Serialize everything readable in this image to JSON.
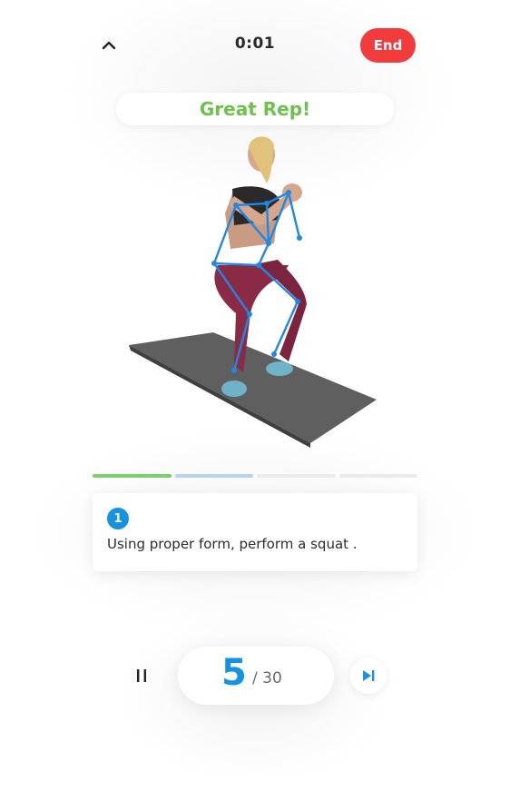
{
  "header": {
    "collapse_icon": "chevron-up-icon",
    "timer": "0:01",
    "end_label": "End"
  },
  "feedback": {
    "message": "Great Rep!",
    "color": "#6cc24a"
  },
  "exercise": {
    "image_description_icon": "squat-figure-with-pose-skeleton",
    "skeleton_color": "#1e88e5"
  },
  "progress": {
    "segments_total": 4,
    "segments_done": 1,
    "segment_active_index": 1
  },
  "step": {
    "number": "1",
    "instruction": "Using proper form, perform a squat ."
  },
  "controls": {
    "pause_icon": "pause-icon",
    "rep_current": "5",
    "rep_total": "/ 30",
    "skip_icon": "skip-next-icon"
  },
  "colors": {
    "accent_blue": "#1592e0",
    "end_red": "#f23b3b",
    "success_green": "#6cc24a"
  }
}
